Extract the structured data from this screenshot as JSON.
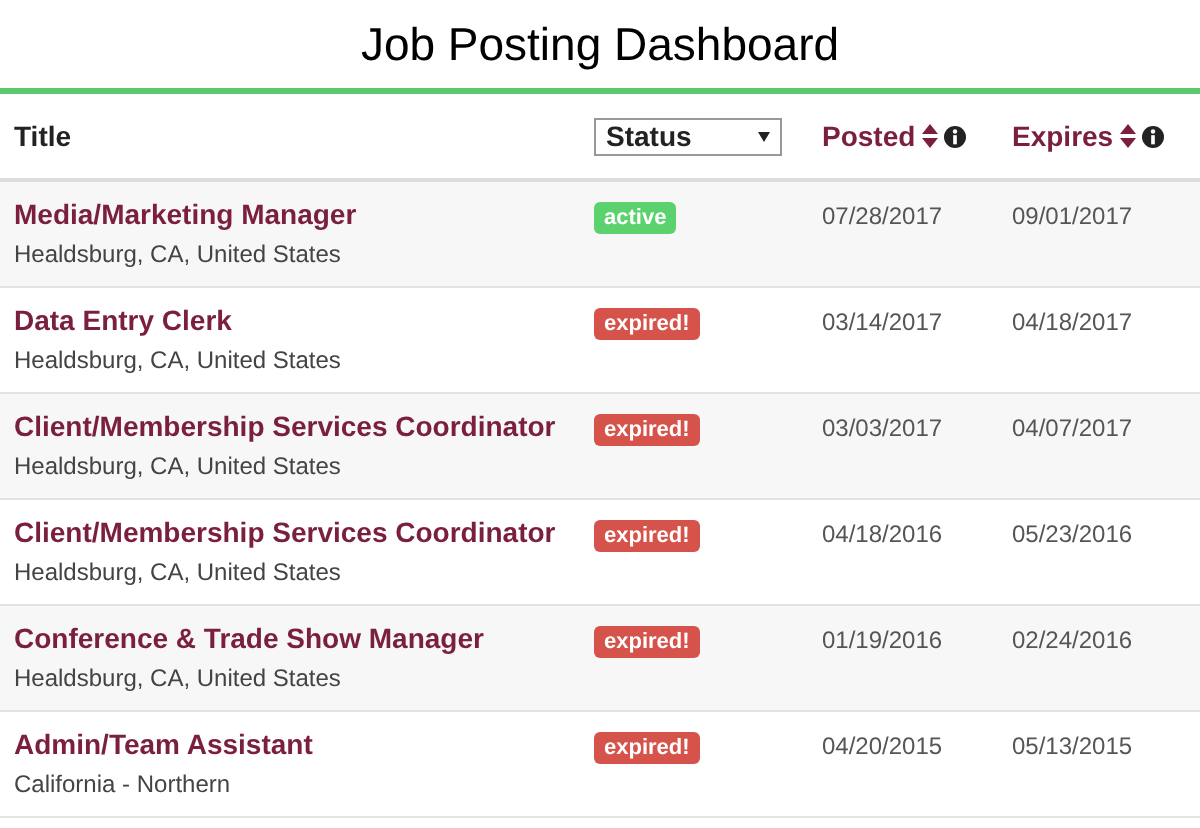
{
  "title": "Job Posting Dashboard",
  "table": {
    "columns": {
      "title": "Title",
      "status_filter": "Status",
      "posted": "Posted",
      "expires": "Expires"
    },
    "rows": [
      {
        "title": "Media/Marketing Manager",
        "location": "Healdsburg, CA, United States",
        "status": {
          "kind": "active",
          "label": "active"
        },
        "posted": "07/28/2017",
        "expires": "09/01/2017"
      },
      {
        "title": "Data Entry Clerk",
        "location": "Healdsburg, CA, United States",
        "status": {
          "kind": "expired",
          "label": "expired!"
        },
        "posted": "03/14/2017",
        "expires": "04/18/2017"
      },
      {
        "title": "Client/Membership Services Coordinator",
        "location": "Healdsburg, CA, United States",
        "status": {
          "kind": "expired",
          "label": "expired!"
        },
        "posted": "03/03/2017",
        "expires": "04/07/2017"
      },
      {
        "title": "Client/Membership Services Coordinator",
        "location": "Healdsburg, CA, United States",
        "status": {
          "kind": "expired",
          "label": "expired!"
        },
        "posted": "04/18/2016",
        "expires": "05/23/2016"
      },
      {
        "title": "Conference & Trade Show Manager",
        "location": "Healdsburg, CA, United States",
        "status": {
          "kind": "expired",
          "label": "expired!"
        },
        "posted": "01/19/2016",
        "expires": "02/24/2016"
      },
      {
        "title": "Admin/Team Assistant",
        "location": "California - Northern",
        "status": {
          "kind": "expired",
          "label": "expired!"
        },
        "posted": "04/20/2015",
        "expires": "05/13/2015"
      }
    ]
  }
}
